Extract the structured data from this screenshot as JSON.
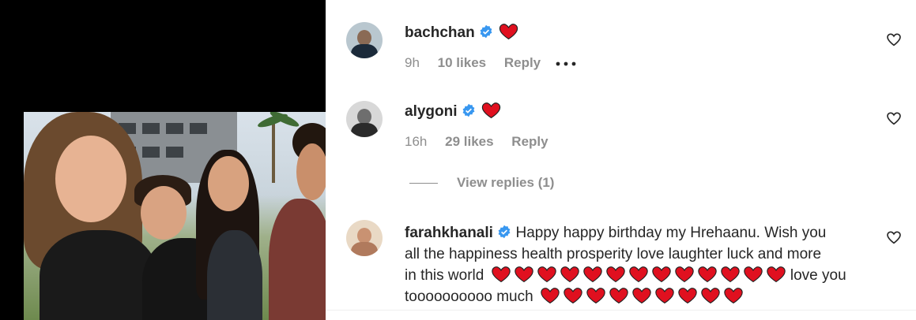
{
  "post": {
    "image_alt": ""
  },
  "icons": {
    "verified": "verified-badge-icon",
    "heart_emoji": "red-heart-emoji",
    "like": "heart-outline-icon",
    "more": "more-options-icon"
  },
  "colors": {
    "username": "#262626",
    "meta": "#8e8e8e",
    "verified": "#3897f0",
    "heart": "#e0101f"
  },
  "comments": [
    {
      "username": "bachchan",
      "verified": true,
      "text": "",
      "emoji_count": 1,
      "time": "9h",
      "likes": "10 likes",
      "reply": "Reply",
      "more": "•••"
    },
    {
      "username": "alygoni",
      "verified": true,
      "text": "",
      "emoji_count": 1,
      "time": "16h",
      "likes": "29 likes",
      "reply": "Reply",
      "view_replies": "View replies (1)"
    },
    {
      "username": "farahkhanali",
      "verified": true,
      "text_line1": "Happy happy birthday my Hrehaanu. Wish you",
      "text_line2": "all the happiness health prosperity love laughter luck and more",
      "text_line3": "in this world",
      "line3_emoji_count": 13,
      "text_line3_end": "love you",
      "text_line4": "toooooooooo much",
      "line4_emoji_count": 9
    }
  ]
}
